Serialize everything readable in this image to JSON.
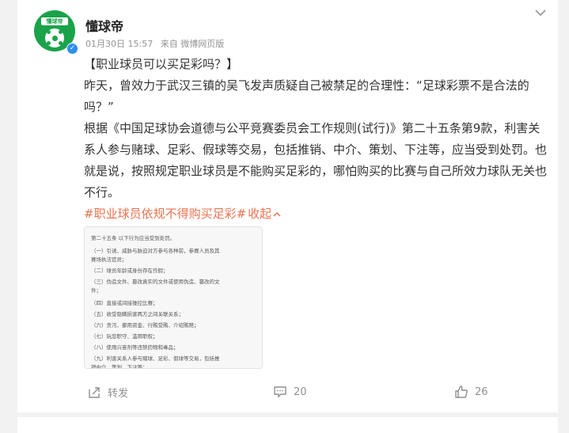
{
  "post": {
    "username": "懂球帝",
    "avatar_label": "懂球帝",
    "timestamp": "01月30日 15:57",
    "source": "来自 微博网页版",
    "title": "【职业球员可以买足彩吗？】",
    "para1": "昨天，曾效力于武汉三镇的吴飞发声质疑自己被禁足的合理性：“足球彩票不是合法的吗？”",
    "para2": "根据《中国足球协会道德与公平竞赛委员会工作规则(试行)》第二十五条第9款，利害关系人参与赌球、足彩、假球等交易，包括推销、中介、策划、下注等，应当受到处罚。也就是说，按照规定职业球员是不能购买足彩的，哪怕购买的比赛与自己所效力球队无关也不行。",
    "hashtag": "#职业球员依规不得购买足彩#",
    "collapse": "收起",
    "image_lines": [
      "第二十五条 以下行为应当受到处罚。",
      "（一）引诱、威胁与胁迫对方参与各种前，参赛人员及其",
      "赛场执法官员；",
      "（二）球员年龄或身份存在作假；",
      "（三）伪造文件、篡改真实的文件或使用伪造、篡改的文",
      "件；",
      "（四）直接或间接操控比赛；",
      "（五）收受隐瞒损害两方之间关联关系；",
      "（六）贪污、挪用资金、行贿受贿、介绍贿赂；",
      "（七）玩忽职守、滥用职权；",
      "（八）使用兴奋剂等违禁药物和毒品；",
      "（九）利害关系人参与赌球、足彩、假球等交易，包括推",
      "销中介、策划、下注等；"
    ]
  },
  "actions": {
    "repost_label": "转发",
    "comment_count": "20",
    "like_count": "26"
  },
  "colors": {
    "link": "#eb7350",
    "brand_green": "#1aa34a",
    "verified_blue": "#2d8ef0"
  },
  "icons": [
    "chevron-down-icon",
    "repost-icon",
    "comment-icon",
    "like-icon",
    "verified-icon"
  ]
}
